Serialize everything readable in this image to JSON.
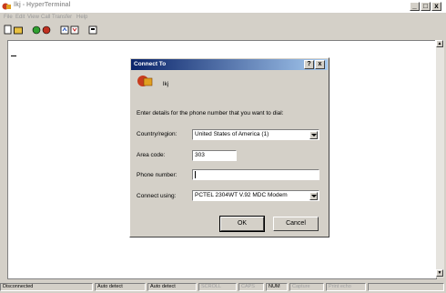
{
  "window": {
    "title": "lkj - HyperTerminal"
  },
  "menu": [
    "File",
    "Edit",
    "View",
    "Call",
    "Transfer",
    "Help"
  ],
  "dialog": {
    "title": "Connect To",
    "help_btn": "?",
    "close_btn": "x",
    "connection_name": "lkj",
    "prompt": "Enter details for the phone number that you want to dial:",
    "country_label": "Country/region:",
    "country_value": "United States of America (1)",
    "area_label": "Area code:",
    "area_value": "303",
    "phone_label": "Phone number:",
    "phone_value": "",
    "connect_label": "Connect using:",
    "connect_value": "PCTEL 2304WT V.92 MDC Modem",
    "ok_label": "OK",
    "cancel_label": "Cancel"
  },
  "status": {
    "connection": "Disconnected",
    "auto1": "Auto detect",
    "auto2": "Auto detect",
    "scroll": "SCROLL",
    "caps": "CAPS",
    "num": "NUM",
    "capture": "Capture",
    "print": "Print echo"
  },
  "colors": {
    "titlebar_start": "#0a246a",
    "titlebar_end": "#a6caf0",
    "face": "#d4d0c8"
  }
}
